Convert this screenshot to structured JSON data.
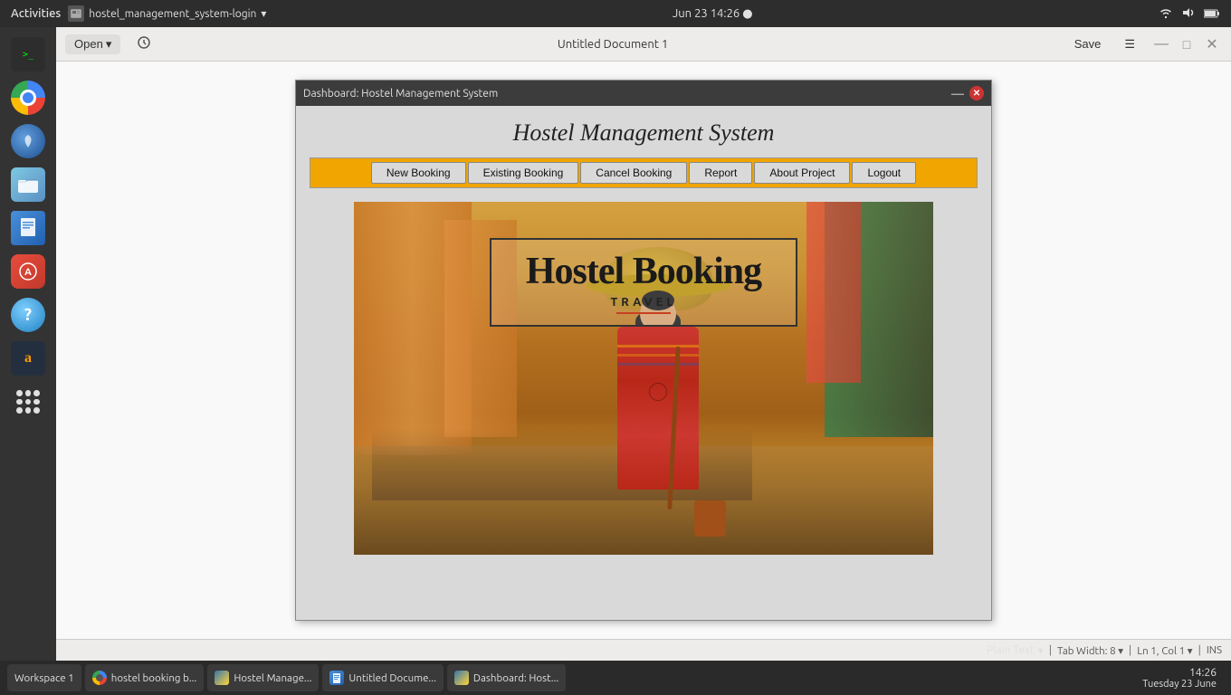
{
  "system_bar": {
    "activities": "Activities",
    "app_name": "hostel_management_system-login",
    "dropdown_arrow": "▾",
    "datetime": "Jun 23  14:26 ●",
    "wifi_icon": "wifi-icon",
    "sound_icon": "sound-icon",
    "battery_icon": "battery-icon"
  },
  "gedit": {
    "title": "Untitled Document 1",
    "open_label": "Open",
    "save_label": "Save",
    "menu_icon": "☰",
    "minimize": "—",
    "maximize": "□",
    "close": "✕"
  },
  "tkinter_app": {
    "title": "Dashboard: Hostel Management System",
    "minimize": "—",
    "close": "✕",
    "app_title": "Hostel Management System",
    "nav_buttons": [
      "New Booking",
      "Existing Booking",
      "Cancel Booking",
      "Report",
      "About Project",
      "Logout"
    ],
    "hero": {
      "main_text": "Hostel Booking",
      "sub_text": "TRAVEL"
    }
  },
  "statusbar": {
    "plain_text": "Plain Text",
    "plain_text_arrow": "▾",
    "tab_width": "Tab Width: 8",
    "tab_width_arrow": "▾",
    "cursor_pos": "Ln 1, Col 1",
    "cursor_arrow": "▾",
    "ins": "INS"
  },
  "taskbar": {
    "items": [
      {
        "label": "Workspace 1",
        "icon_color": "#555"
      },
      {
        "label": "hostel booking b...",
        "icon": "chrome"
      },
      {
        "label": "Hostel Manage...",
        "icon": "python"
      },
      {
        "label": "Untitled Docume...",
        "icon": "gedit"
      },
      {
        "label": "Dashboard: Host...",
        "icon": "python2"
      }
    ],
    "time": "14:26",
    "date": "Tuesday 23 June"
  },
  "dock": {
    "items": [
      {
        "name": "terminal",
        "label": ">_"
      },
      {
        "name": "chrome",
        "label": ""
      },
      {
        "name": "thunderbird",
        "label": ""
      },
      {
        "name": "files",
        "label": "📁"
      },
      {
        "name": "writer",
        "label": ""
      },
      {
        "name": "appstore",
        "label": ""
      },
      {
        "name": "help",
        "label": "?"
      },
      {
        "name": "amazon",
        "label": "a"
      },
      {
        "name": "apps",
        "label": ""
      }
    ]
  }
}
